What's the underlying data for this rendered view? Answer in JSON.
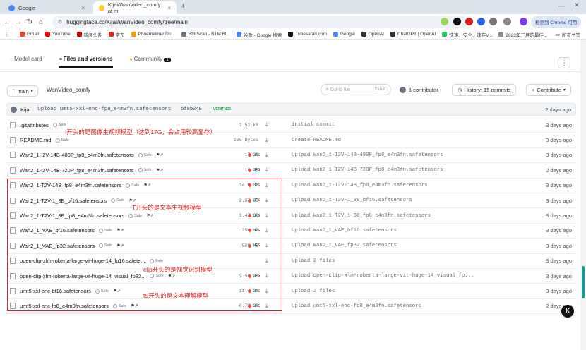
{
  "browser": {
    "tabs": [
      {
        "title": "Google"
      },
      {
        "title": "Kijai/WanVideo_comfy at m"
      }
    ],
    "address": "huggingface.co/Kijai/WanVideo_comfy/tree/main",
    "profile_label": "检测到 Chrome 可用",
    "bookmarks": [
      "Gmail",
      "YouTube",
      "新闻头条",
      "京东",
      "Phoemeimer Do...",
      "BtmScan - BTM Bl...",
      "谷歌 - Google 搜索",
      "Tubesafari.com",
      "Google",
      "OpenAI",
      "ChatGPT | OpenAI",
      "快速、安全、速在V...",
      "2023年三月的最佳..."
    ],
    "bookmarks_folder": "所有书签",
    "colors": {
      "accent_red": "#e11d1d",
      "verified_green": "#16a34a",
      "lfs_red": "#ef4444"
    }
  },
  "repo_tabs": {
    "model_card": "Model card",
    "files": "Files and versions",
    "community": "Community",
    "community_count": "1"
  },
  "toolbar": {
    "branch": "main",
    "repo_name": "WanVideo_comfy",
    "search_placeholder": "Go to file",
    "search_kbd": "Ctrl+K",
    "contributors": "1 contributor",
    "history": "History: 15 commits",
    "contribute": "Contribute"
  },
  "last_commit": {
    "user": "Kijai",
    "message": "Upload umt5-xxl-enc-fp8_e4m3fn.safetensors",
    "hash": "5f8b249",
    "badge": "VERIFIED",
    "date": "2 days ago"
  },
  "files": [
    {
      "name": ".gitattributes",
      "safe": "Safe",
      "size": "1.52 kB",
      "lfs": "",
      "commit": "initial commit",
      "date": "3 days ago"
    },
    {
      "name": "README.md",
      "safe": "Safe",
      "size": "166 Bytes",
      "lfs": "",
      "commit": "Create README.md",
      "date": "3 days ago"
    },
    {
      "name": "Wan2_1-I2V-14B-480P_fp8_e4m3fn.safetensors",
      "safe": "Safe",
      "size": "17 GB",
      "lfs": "LFS",
      "commit": "Upload Wan2_1-I2V-14B-480P_fp8_e4m3fn.safetensors",
      "date": "3 days ago"
    },
    {
      "name": "Wan2_1-I2V-14B-720P_fp8_e4m3fn.safetensors",
      "safe": "Safe",
      "size": "17 GB",
      "lfs": "LFS",
      "commit": "Upload Wan2_1-I2V-14B-720P_fp8_e4m3fn.safetensors",
      "date": "2 days ago"
    },
    {
      "name": "Wan2_1-T2V-14B_fp8_e4m3fn.safetensors",
      "safe": "Safe",
      "size": "14.9 GB",
      "lfs": "LFS",
      "commit": "Upload Wan2_1-T2V-14B_fp8_e4m3fn.safetensors",
      "date": "3 days ago"
    },
    {
      "name": "Wan2_1-T2V-1_3B_bf16.safetensors",
      "safe": "Safe",
      "size": "2.87 GB",
      "lfs": "LFS",
      "commit": "Upload Wan2_1-T2V-1_3B_bf16.safetensors",
      "date": "3 days ago"
    },
    {
      "name": "Wan2_1-T2V-1_3B_fp8_e4m3fn.safetensors",
      "safe": "Safe",
      "size": "1.47 GB",
      "lfs": "LFS",
      "commit": "Upload Wan2_1-T2V-1_3B_fp8_e4m3fn.safetensors",
      "date": "3 days ago"
    },
    {
      "name": "Wan2_1_VAE_bf16.safetensors",
      "safe": "Safe",
      "size": "254 MB",
      "lfs": "LFS",
      "commit": "Upload Wan2_1_VAE_bf16.safetensors",
      "date": "3 days ago"
    },
    {
      "name": "Wan2_1_VAE_fp32.safetensors",
      "safe": "Safe",
      "size": "508 MB",
      "lfs": "LFS",
      "commit": "Upload Wan2_1_VAE_fp32.safetensors",
      "date": "3 days ago"
    },
    {
      "name": "open-clip-xlm-roberta-large-vit-huge-14_fp16.safete...",
      "safe": "Safe",
      "size": "",
      "lfs": "",
      "commit": "Upload 2 files",
      "date": "3 days ago"
    },
    {
      "name": "open-clip-xlm-roberta-large-vit-huge-14_visual_fp32...",
      "safe": "Safe",
      "size": "2.53 GB",
      "lfs": "LFS",
      "commit": "Upload open-clip-xlm-roberta-large-vit-huge-14_visual_fp...",
      "date": "3 days ago"
    },
    {
      "name": "umt5-xxl-enc-bf16.safetensors",
      "safe": "Safe",
      "size": "11.4 GB",
      "lfs": "LFS",
      "commit": "Upload 2 files",
      "date": "3 days ago"
    },
    {
      "name": "umt5-xxl-enc-fp8_e4m3fn.safetensors",
      "safe": "Safe",
      "size": "6.73 GB",
      "lfs": "LFS",
      "commit": "Upload umt5-xxl-enc-fp8_e4m3fn.safetensors",
      "date": "2 days ago"
    }
  ],
  "annotations": [
    "I开头的是图像生视频模型（达到17G，会占用较高显存）",
    "T开头的是文本生视频模型",
    "clip开头的是视觉识别模型",
    "t5开头的是文本理解模型"
  ]
}
